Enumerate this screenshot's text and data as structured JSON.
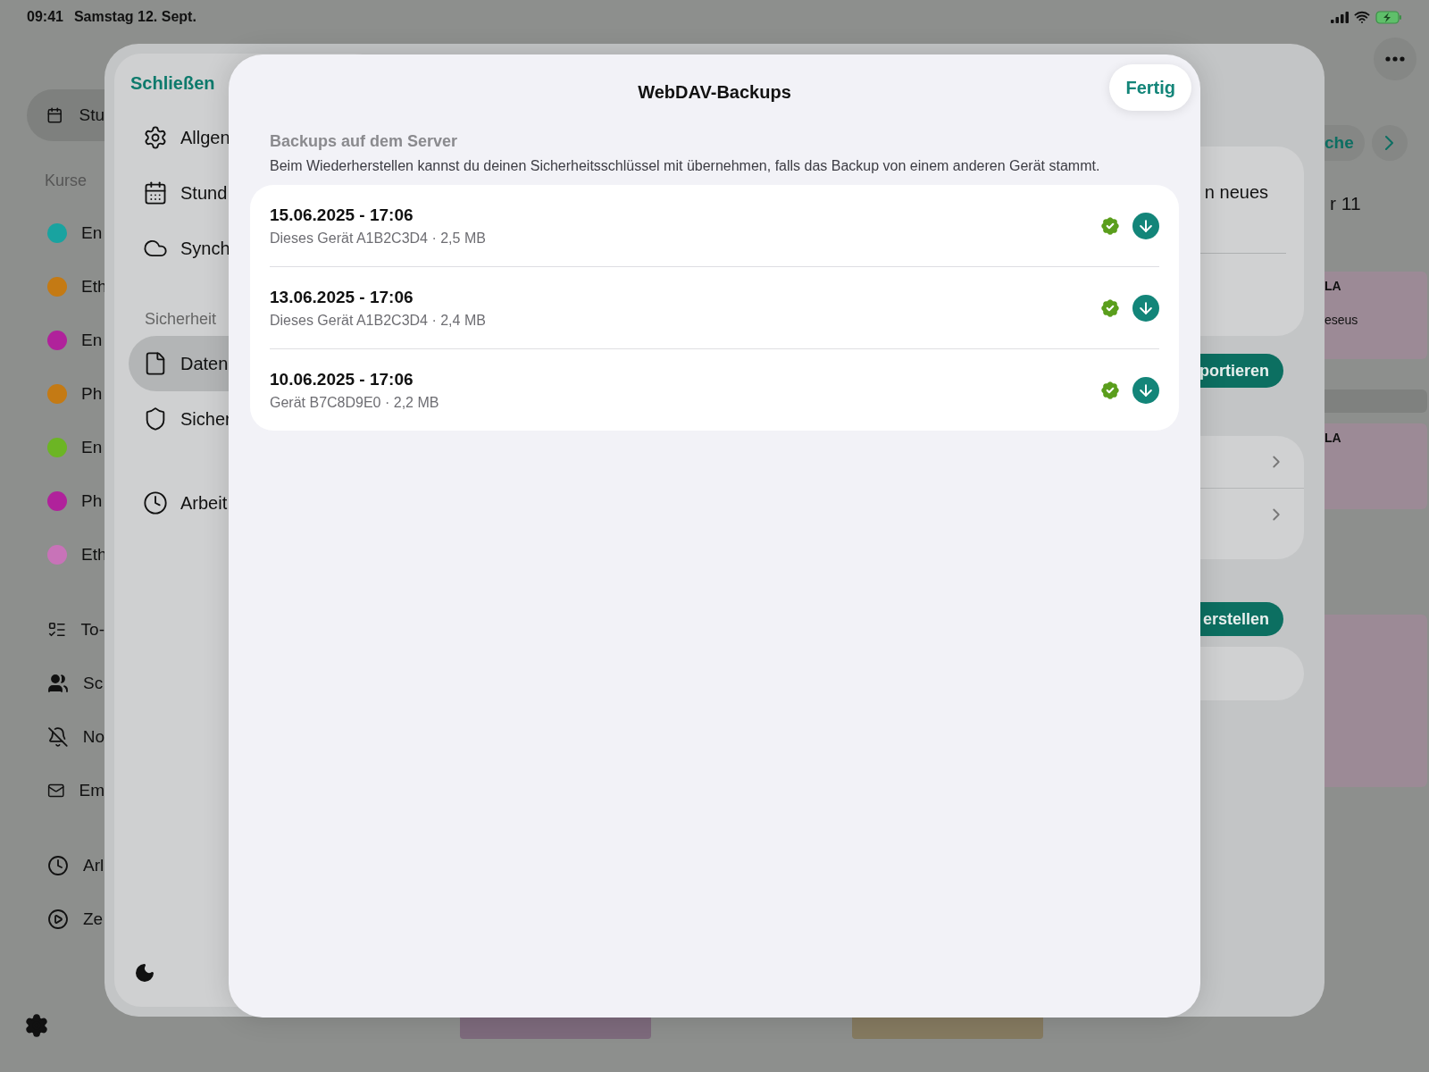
{
  "status_bar": {
    "time": "09:41",
    "date": "Samstag 12. Sept."
  },
  "background": {
    "sidebar": {
      "top_item": {
        "label": "Stu",
        "selected": true
      },
      "section": "Kurse",
      "courses": [
        {
          "label": "En",
          "color": "#19a3a0"
        },
        {
          "label": "Eth",
          "color": "#c47a14"
        },
        {
          "label": "En",
          "color": "#b0229b"
        },
        {
          "label": "Ph",
          "color": "#c47a14"
        },
        {
          "label": "En",
          "color": "#6cb524"
        },
        {
          "label": "Ph",
          "color": "#b0229b"
        },
        {
          "label": "Eth",
          "color": "#c873b8"
        }
      ],
      "items": [
        {
          "label": "To-",
          "kind": "todo"
        },
        {
          "label": "Sc",
          "kind": "people"
        },
        {
          "label": "No",
          "kind": "bell-off"
        },
        {
          "label": "Em",
          "kind": "mail"
        }
      ],
      "items_2": [
        {
          "label": "Arl",
          "kind": "clock"
        },
        {
          "label": "Ze",
          "kind": "play"
        }
      ]
    },
    "week_button": "che",
    "heading": "r 11",
    "events": [
      {
        "title": "LA",
        "subtitle": "eseus"
      },
      {
        "title": "LA"
      }
    ]
  },
  "settings": {
    "close": "Schließen",
    "groups": [
      {
        "items": [
          {
            "label": "Allgen",
            "kind": "gear",
            "selected": false
          },
          {
            "label": "Stund",
            "kind": "calendar",
            "selected": false
          },
          {
            "label": "Synch",
            "kind": "cloud",
            "selected": false
          }
        ]
      },
      {
        "header": "Sicherheit",
        "items": [
          {
            "label": "Daten",
            "kind": "file",
            "selected": true
          },
          {
            "label": "Sicher",
            "kind": "shield",
            "selected": false
          }
        ]
      },
      {
        "items": [
          {
            "label": "Arbeit",
            "kind": "clock",
            "selected": false
          }
        ]
      }
    ],
    "card_text": "n neues",
    "export_button": "portieren",
    "create_button": "erstellen"
  },
  "modal": {
    "title": "WebDAV-Backups",
    "done": "Fertig",
    "section_header": "Backups auf dem Server",
    "description": "Beim Wiederherstellen kannst du deinen Sicherheitsschlüssel mit übernehmen, falls das Backup von einem anderen Gerät stammt.",
    "backups": [
      {
        "title": "15.06.2025 - 17:06",
        "subtitle": "Dieses Gerät A1B2C3D4 · 2,5 MB",
        "verified": true
      },
      {
        "title": "13.06.2025 - 17:06",
        "subtitle": "Dieses Gerät A1B2C3D4 · 2,4 MB",
        "verified": true
      },
      {
        "title": "10.06.2025 - 17:06",
        "subtitle": "Gerät B7C8D9E0 · 2,2 MB",
        "verified": true
      }
    ]
  }
}
